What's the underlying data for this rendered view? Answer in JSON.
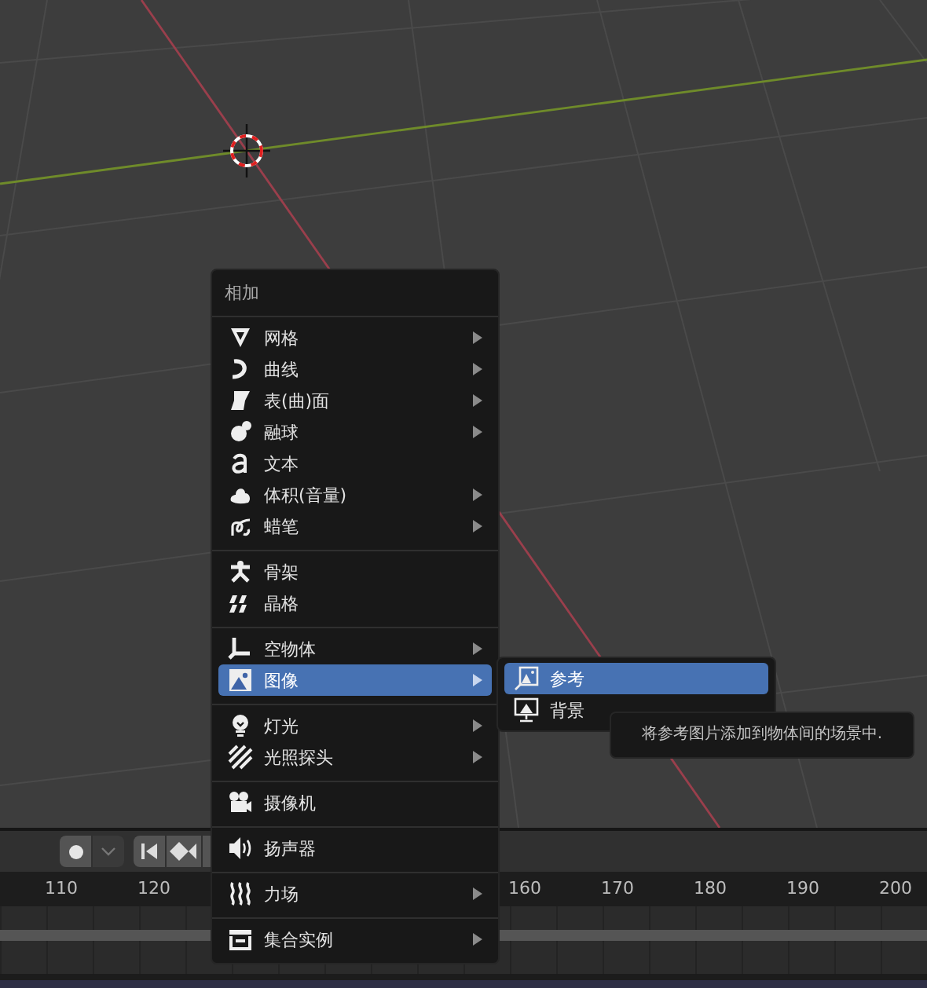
{
  "add_menu": {
    "title": "相加",
    "sections": [
      [
        {
          "label": "网格",
          "has_submenu": true,
          "selected": false
        },
        {
          "label": "曲线",
          "has_submenu": true,
          "selected": false
        },
        {
          "label": "表(曲)面",
          "has_submenu": true,
          "selected": false
        },
        {
          "label": "融球",
          "has_submenu": true,
          "selected": false
        },
        {
          "label": "文本",
          "has_submenu": false,
          "selected": false
        },
        {
          "label": "体积(音量)",
          "has_submenu": true,
          "selected": false
        },
        {
          "label": "蜡笔",
          "has_submenu": true,
          "selected": false
        }
      ],
      [
        {
          "label": "骨架",
          "has_submenu": false,
          "selected": false
        },
        {
          "label": "晶格",
          "has_submenu": false,
          "selected": false
        }
      ],
      [
        {
          "label": "空物体",
          "has_submenu": true,
          "selected": false
        },
        {
          "label": "图像",
          "has_submenu": true,
          "selected": true
        }
      ],
      [
        {
          "label": "灯光",
          "has_submenu": true,
          "selected": false
        },
        {
          "label": "光照探头",
          "has_submenu": true,
          "selected": false
        }
      ],
      [
        {
          "label": "摄像机",
          "has_submenu": false,
          "selected": false
        }
      ],
      [
        {
          "label": "扬声器",
          "has_submenu": false,
          "selected": false
        }
      ],
      [
        {
          "label": "力场",
          "has_submenu": true,
          "selected": false
        }
      ],
      [
        {
          "label": "集合实例",
          "has_submenu": true,
          "selected": false
        }
      ]
    ]
  },
  "image_submenu": {
    "items": [
      {
        "label": "参考",
        "selected": true
      },
      {
        "label": "背景",
        "selected": false
      }
    ]
  },
  "tooltip": "将参考图片添加到物体间的场景中.",
  "timeline": {
    "frame_labels": [
      "110",
      "120",
      "160",
      "170",
      "180",
      "190",
      "200"
    ]
  }
}
